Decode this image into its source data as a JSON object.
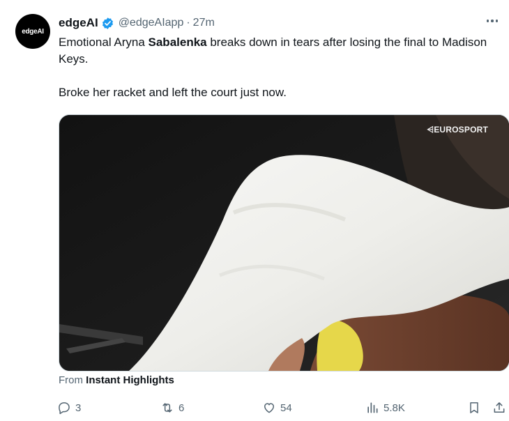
{
  "author": {
    "avatar_text": "edgeAI",
    "name": "edgeAI",
    "handle": "@edgeAIapp",
    "separator": "·",
    "time": "27m"
  },
  "tweet": {
    "line1_pre": "Emotional Aryna ",
    "line1_bold": "Sabalenka",
    "line1_post": " breaks down in tears after losing the final to Madison Keys.",
    "line2": "Broke her racket and left the court just now."
  },
  "media": {
    "watermark": "EUROSPORT"
  },
  "source": {
    "prefix": "From ",
    "name": "Instant Highlights"
  },
  "actions": {
    "replies": "3",
    "reposts": "6",
    "likes": "54",
    "views": "5.8K"
  },
  "colors": {
    "verified": "#1d9bf0",
    "muted": "#536471",
    "text": "#0f1419"
  },
  "icons": [
    "verified-badge-icon",
    "more-icon",
    "reply-icon",
    "repost-icon",
    "like-icon",
    "views-icon",
    "bookmark-icon",
    "share-icon"
  ]
}
